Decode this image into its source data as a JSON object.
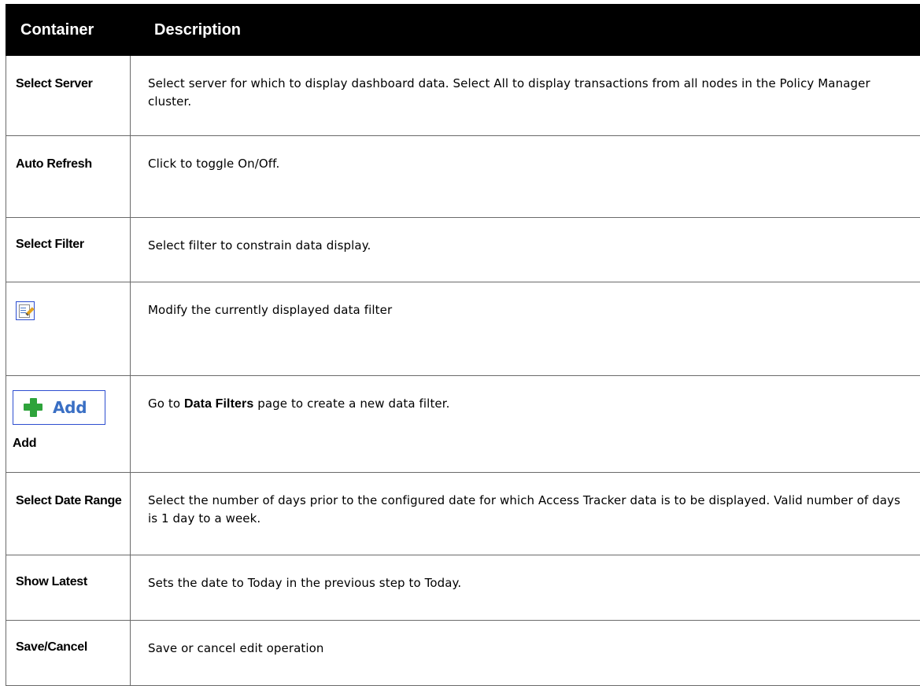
{
  "table": {
    "headers": {
      "container": "Container",
      "description": "Description"
    },
    "rows": [
      {
        "name": "Select Server",
        "description": "Select server for which to display dashboard data. Select All to display transactions from all nodes in the Policy Manager cluster."
      },
      {
        "name": "Auto Refresh",
        "description": "Click to toggle On/Off."
      },
      {
        "name": "Select Filter",
        "description": "Select filter to constrain data display."
      },
      {
        "icon": "edit-filter-icon",
        "description": "Modify the currently displayed data filter"
      },
      {
        "button_text": "Add",
        "name": "Add",
        "icon": "green-plus-icon",
        "description_before": "Go to ",
        "description_bold": "Data Filters",
        "description_after": " page to create a new data filter."
      },
      {
        "name": "Select Date Range",
        "description": "Select the number of days prior to the configured date for which Access Tracker data is to be displayed. Valid number of days is 1 day to a week."
      },
      {
        "name": "Show Latest",
        "description": "Sets the date to Today in the previous step to Today."
      },
      {
        "name": "Save/Cancel",
        "description": "Save or cancel edit operation"
      }
    ]
  },
  "colors": {
    "header_bg": "#000000",
    "header_text": "#ffffff",
    "border": "#6a6a6a",
    "add_text": "#3a6fc4",
    "plus_green": "#2ea33b",
    "button_border": "#2e4fd0"
  }
}
